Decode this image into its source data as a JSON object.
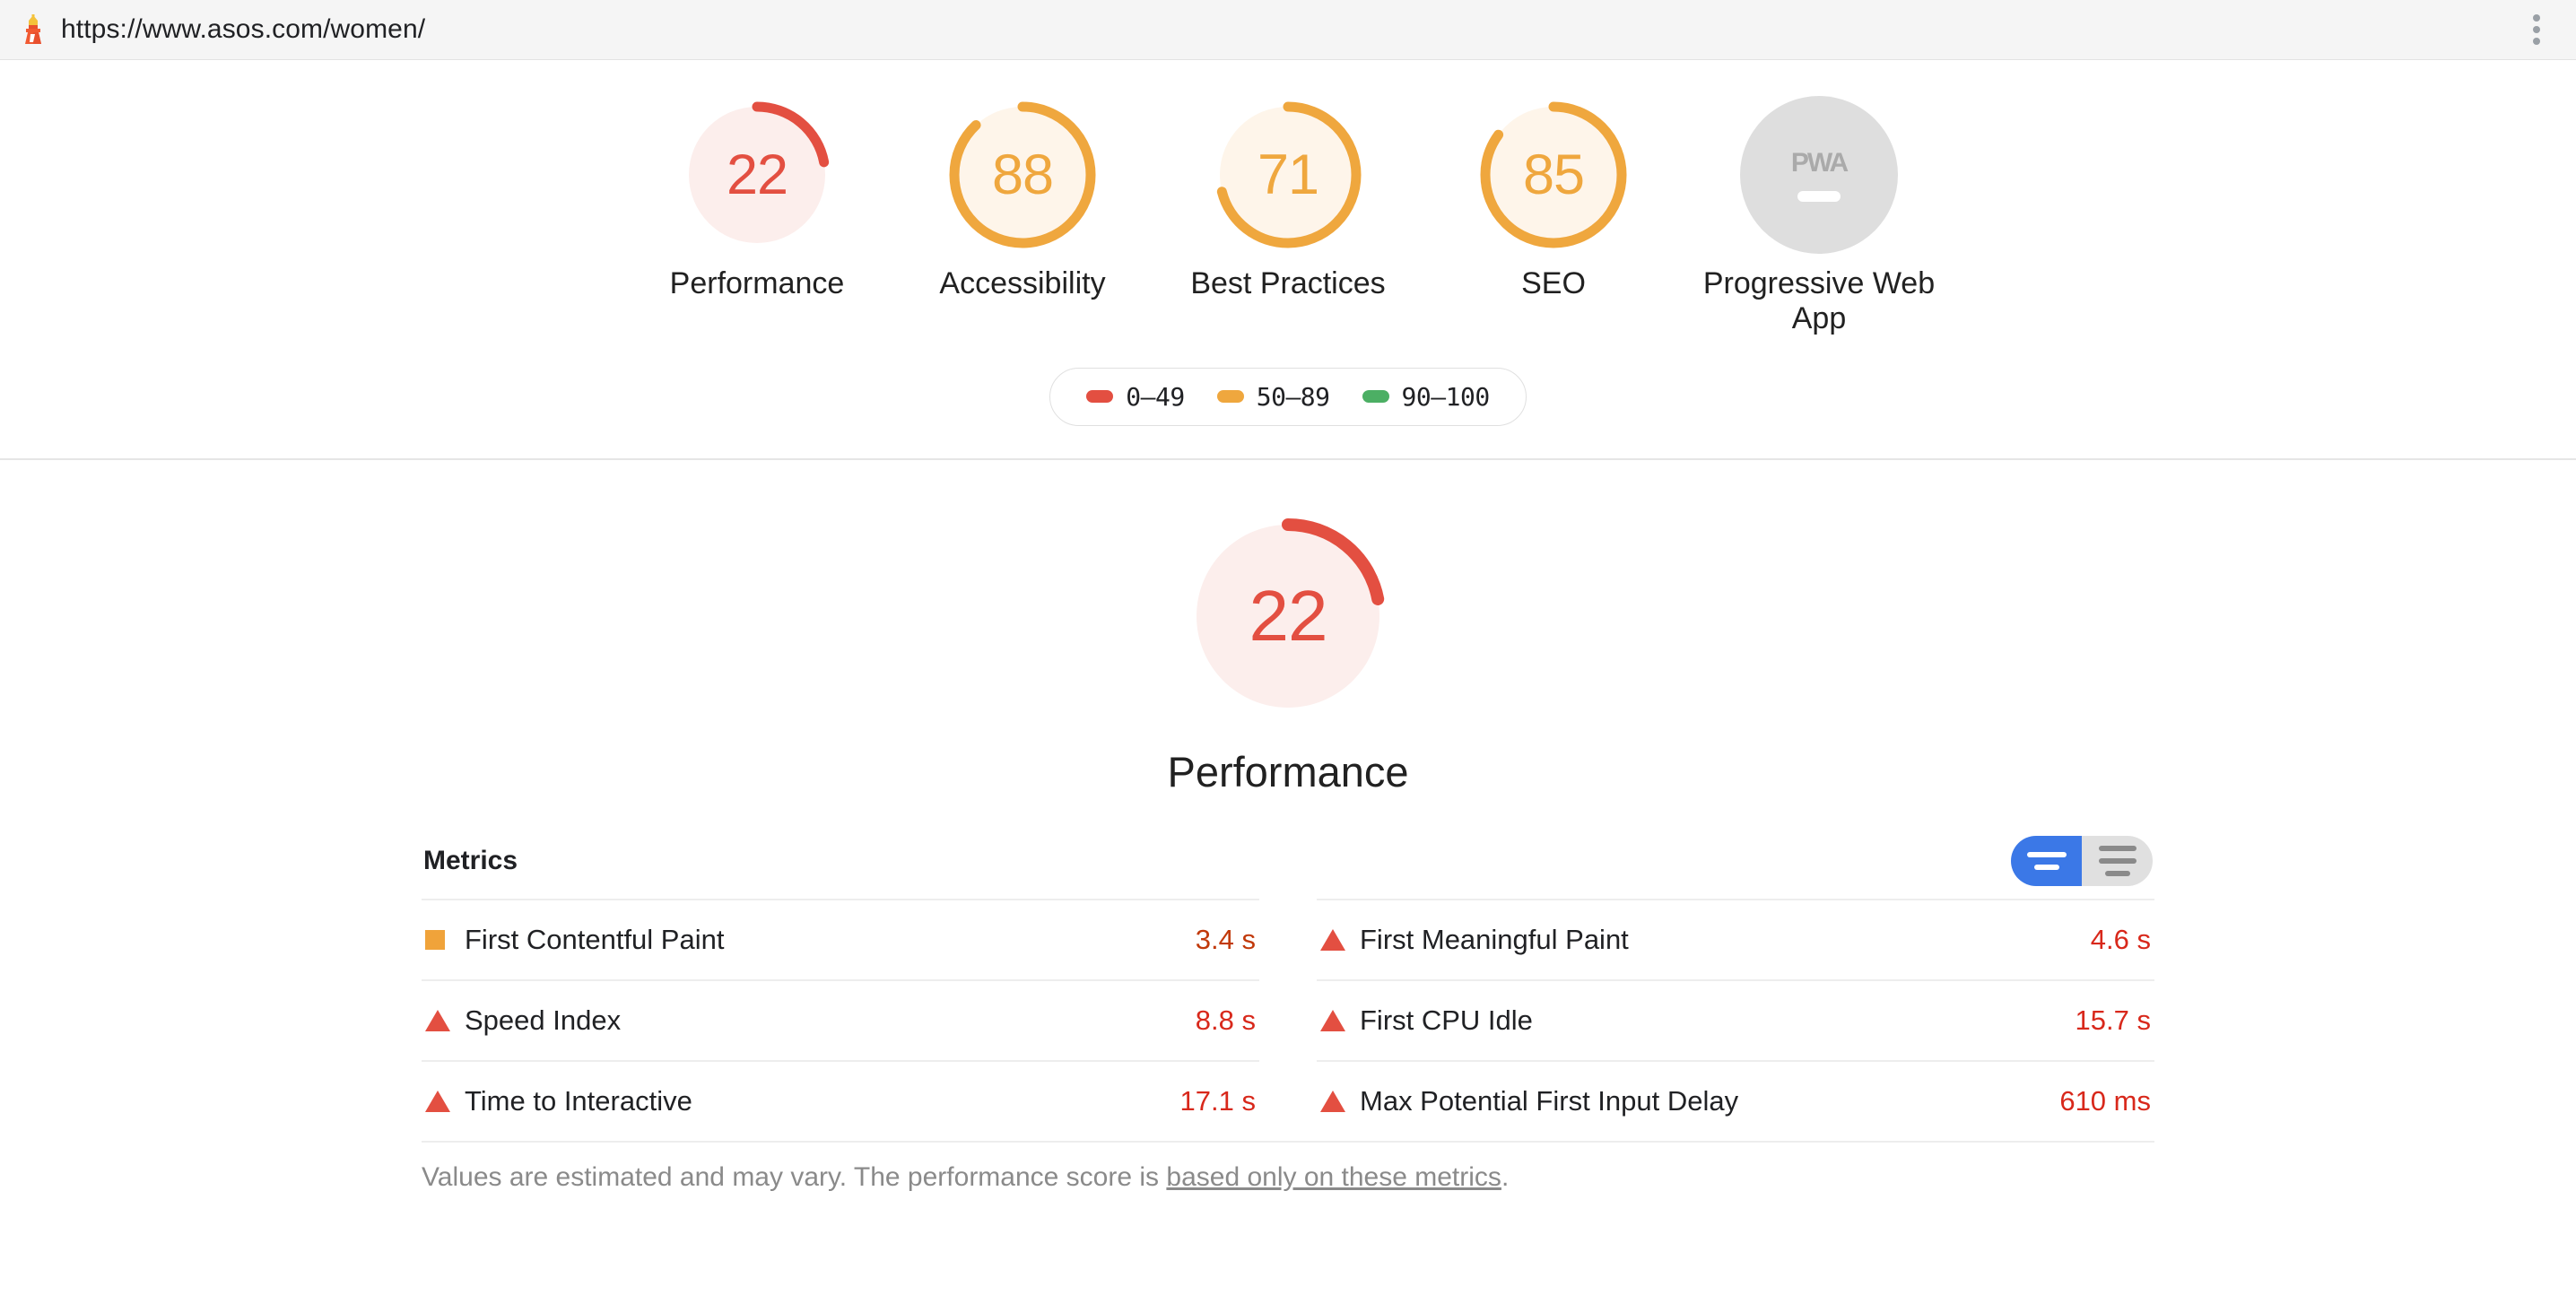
{
  "header": {
    "url": "https://www.asos.com/women/",
    "favicon": "lighthouse-icon",
    "menu_icon": "kebab-menu-icon"
  },
  "summary": {
    "gauges": [
      {
        "label": "Performance",
        "score": "22",
        "score_num": 22,
        "state": "fail",
        "color": "#E34F41",
        "bg": "#FCEEEC"
      },
      {
        "label": "Accessibility",
        "score": "88",
        "score_num": 88,
        "state": "average",
        "color": "#EFA73E",
        "bg": "#FEF5EA"
      },
      {
        "label": "Best Practices",
        "score": "71",
        "score_num": 71,
        "state": "average",
        "color": "#EFA73E",
        "bg": "#FEF5EA"
      },
      {
        "label": "SEO",
        "score": "85",
        "score_num": 85,
        "state": "average",
        "color": "#EFA73E",
        "bg": "#FEF5EA"
      },
      {
        "label": "Progressive Web App",
        "score": "PWA",
        "score_num": null,
        "state": "not-applicable",
        "color": "#AAAAAA",
        "bg": "#DEDEDE"
      }
    ],
    "legend": [
      {
        "range": "0–49",
        "color": "#E34F41"
      },
      {
        "range": "50–89",
        "color": "#EFA73E"
      },
      {
        "range": "90–100",
        "color": "#4CAF64"
      }
    ]
  },
  "performance": {
    "score": "22",
    "score_num": 22,
    "color": "#E34F41",
    "bg": "#FCEEEC",
    "title": "Performance",
    "metrics_title": "Metrics",
    "toggle": {
      "compact_label": "compact-view",
      "expanded_label": "expanded-view",
      "selected": "compact"
    },
    "metrics_left": [
      {
        "icon": "square-average-icon",
        "name": "First Contentful Paint",
        "value": "3.4 s",
        "severity": "average"
      },
      {
        "icon": "triangle-fail-icon",
        "name": "Speed Index",
        "value": "8.8 s",
        "severity": "fail"
      },
      {
        "icon": "triangle-fail-icon",
        "name": "Time to Interactive",
        "value": "17.1 s",
        "severity": "fail"
      }
    ],
    "metrics_right": [
      {
        "icon": "triangle-fail-icon",
        "name": "First Meaningful Paint",
        "value": "4.6 s",
        "severity": "fail"
      },
      {
        "icon": "triangle-fail-icon",
        "name": "First CPU Idle",
        "value": "15.7 s",
        "severity": "fail"
      },
      {
        "icon": "triangle-fail-icon",
        "name": "Max Potential First Input Delay",
        "value": "610 ms",
        "severity": "fail"
      }
    ],
    "footer_prefix": "Values are estimated and may vary. The performance score is ",
    "footer_link": "based only on these metrics",
    "footer_suffix": "."
  }
}
